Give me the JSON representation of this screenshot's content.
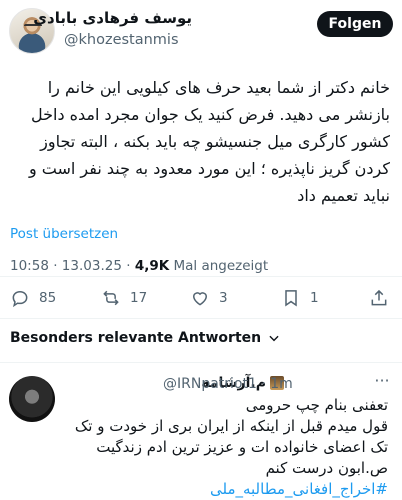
{
  "tweet": {
    "author_name": "یوسف فرهادی بابادی",
    "author_handle": "@khozestanmis",
    "follow_label": "Folgen",
    "text": "خانم دکتر از شما بعید حرف های کیلویی این خانم را بازنشر می دهید. فرض کنید یک جوان مجرد امده داخل کشور کارگری میل جنسیشو چه باید بکنه ، البته تجاوز کردن گریز ناپذیره ؛ این مورد معدود به چند نفر است و نباید تعمیم داد",
    "translate_label": "Post übersetzen",
    "time": "10:58",
    "date": "13.03.25",
    "views": "4,9K",
    "views_label": "Mal angezeigt",
    "separator": "·"
  },
  "actions": {
    "replies": "85",
    "reposts": "17",
    "likes": "3",
    "bookmarks": "1"
  },
  "replies_section": {
    "sort_label": "Besonders relevante Antworten"
  },
  "reply": {
    "author_name": "م.آرشامه",
    "author_handle": "@IRNpatriot1",
    "time": "1m",
    "line1": "تعفنی بنام چپ حرومی",
    "line2": "قول میدم قبل از اینکه از ایران بری از خودت و تک تک اعضای خانواده ات و عزیز ترین ادم زندگیت ص.ابون درست کنم",
    "hashtag": "#اخراج_افغانی_مطالبه_ملی"
  },
  "colors": {
    "accent": "#1d9bf0",
    "text": "#0f1419",
    "muted": "#536471"
  }
}
